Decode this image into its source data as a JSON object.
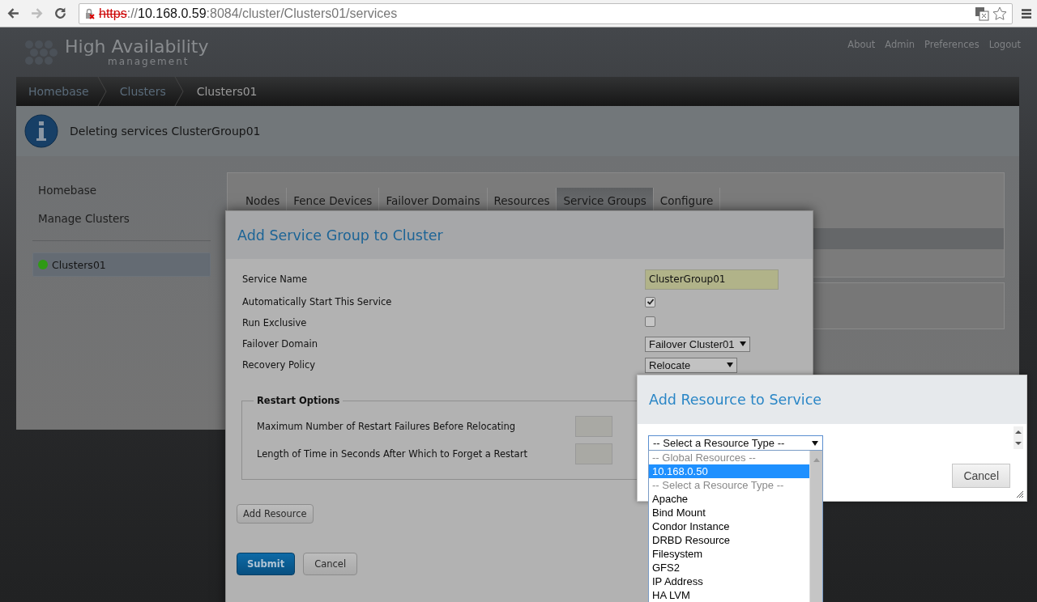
{
  "browser": {
    "url_scheme": "https",
    "url_sep": "://",
    "url_host": "10.168.0.59",
    "url_rest": ":8084/cluster/Clusters01/services"
  },
  "header": {
    "logo_title": "High Availability",
    "logo_subtitle": "management",
    "links": [
      "About",
      "Admin",
      "Preferences",
      "Logout"
    ]
  },
  "breadcrumb": [
    {
      "label": "Homebase",
      "current": false
    },
    {
      "label": "Clusters",
      "current": false
    },
    {
      "label": "Clusters01",
      "current": true
    }
  ],
  "notice": "Deleting services ClusterGroup01",
  "sidebar": {
    "items": [
      "Homebase",
      "Manage Clusters"
    ],
    "clusters": [
      {
        "label": "Clusters01",
        "selected": true,
        "color": "#2f9a14"
      }
    ]
  },
  "tabs": [
    {
      "label": "Nodes",
      "selected": false
    },
    {
      "label": "Fence Devices",
      "selected": false
    },
    {
      "label": "Failover Domains",
      "selected": false
    },
    {
      "label": "Resources",
      "selected": false
    },
    {
      "label": "Service Groups",
      "selected": true
    },
    {
      "label": "Configure",
      "selected": false
    }
  ],
  "service_dialog": {
    "title": "Add Service Group to Cluster",
    "fields": [
      {
        "kind": "text",
        "label": "Service Name",
        "value": "ClusterGroup01"
      },
      {
        "kind": "checkbox",
        "label": "Automatically Start This Service",
        "checked": true
      },
      {
        "kind": "checkbox",
        "label": "Run Exclusive",
        "checked": false
      },
      {
        "kind": "select",
        "label": "Failover Domain",
        "value": "Failover Cluster01"
      },
      {
        "kind": "select",
        "label": "Recovery Policy",
        "value": "Relocate"
      }
    ],
    "restart_options": {
      "legend": "Restart Options",
      "fields": [
        "Maximum Number of Restart Failures Before Relocating",
        "Length of Time in Seconds After Which to Forget a Restart"
      ]
    },
    "add_resource_button": "Add Resource",
    "submit_button": "Submit",
    "cancel_button": "Cancel"
  },
  "resource_dialog": {
    "title": "Add Resource to Service",
    "select_value": "-- Select a Resource Type --",
    "cancel_button": "Cancel",
    "options": [
      {
        "kind": "group",
        "label": "-- Global Resources --",
        "selected": false
      },
      {
        "kind": "option",
        "label": "10.168.0.50",
        "selected": true
      },
      {
        "kind": "group",
        "label": "-- Select a Resource Type --",
        "selected": false
      },
      {
        "kind": "option",
        "label": "Apache",
        "selected": false
      },
      {
        "kind": "option",
        "label": "Bind Mount",
        "selected": false
      },
      {
        "kind": "option",
        "label": "Condor Instance",
        "selected": false
      },
      {
        "kind": "option",
        "label": "DRBD Resource",
        "selected": false
      },
      {
        "kind": "option",
        "label": "Filesystem",
        "selected": false
      },
      {
        "kind": "option",
        "label": "GFS2",
        "selected": false
      },
      {
        "kind": "option",
        "label": "IP Address",
        "selected": false
      },
      {
        "kind": "option",
        "label": "HA LVM",
        "selected": false
      }
    ]
  }
}
